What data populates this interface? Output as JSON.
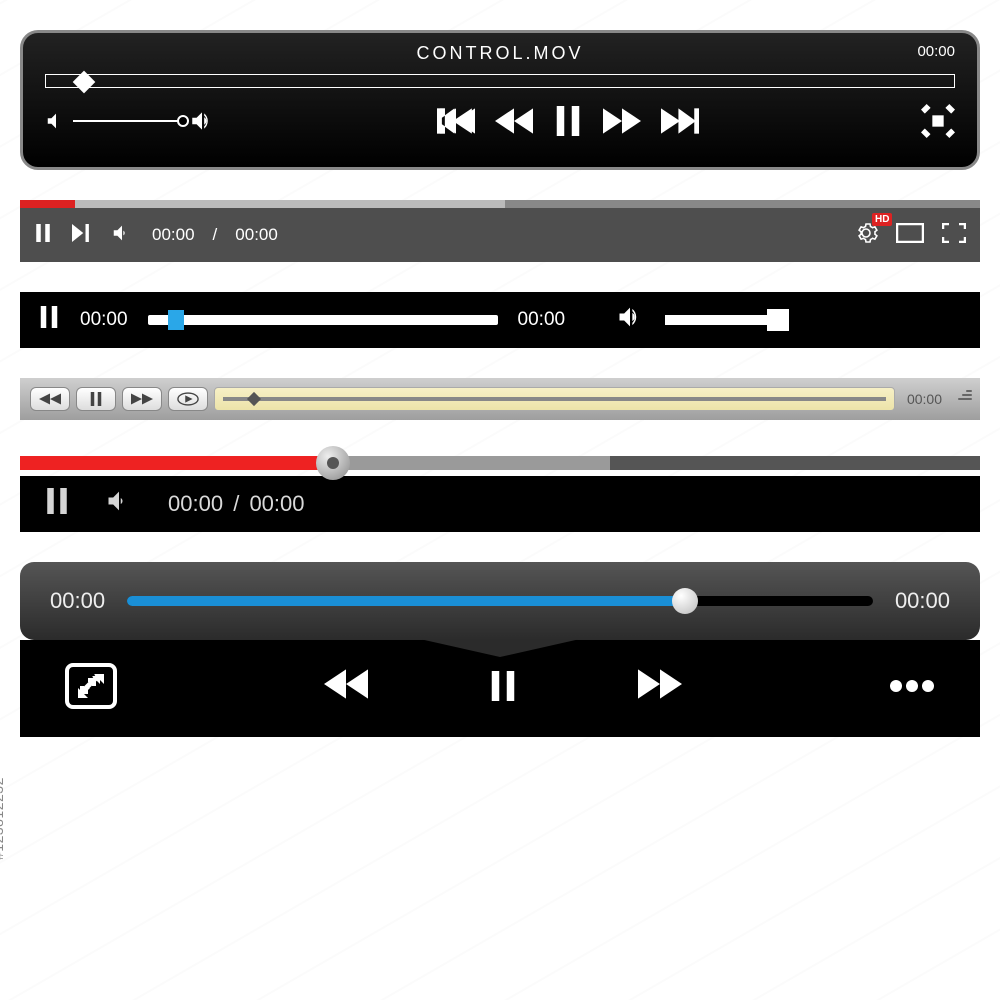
{
  "meta": {
    "stock_id": "#123812232"
  },
  "p1": {
    "title": "CONTROL.MOV",
    "time": "00:00"
  },
  "p2": {
    "current": "00:00",
    "sep": "/",
    "duration": "00:00",
    "hd": "HD"
  },
  "p3": {
    "left_time": "00:00",
    "right_time": "00:00"
  },
  "p4": {
    "time": "00:00"
  },
  "p5": {
    "current": "00:00",
    "sep": "/",
    "duration": "00:00"
  },
  "p6": {
    "left_time": "00:00",
    "right_time": "00:00"
  }
}
